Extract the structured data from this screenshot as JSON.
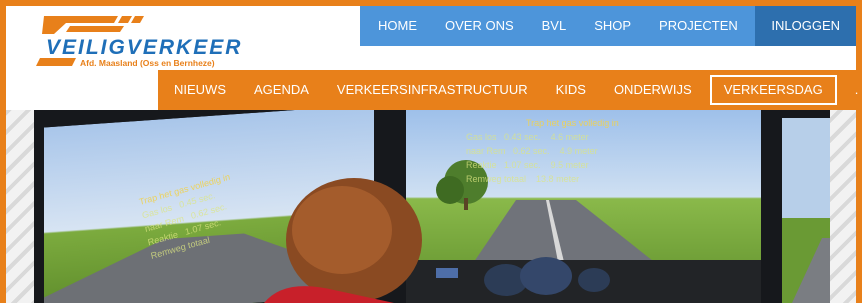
{
  "logo": {
    "wordmark": "VEILIGVERKEER",
    "subtitle": "Afd. Maasland (Oss en Bernheze)"
  },
  "top_nav": [
    "HOME",
    "OVER ONS",
    "BVL",
    "SHOP",
    "PROJECTEN"
  ],
  "login_label": "INLOGGEN",
  "sub_nav": [
    "NIEUWS",
    "AGENDA",
    "VERKEERSINFRASTRUCTUUR",
    "KIDS",
    "ONDERWIJS",
    "VERKEERSDAG",
    "."
  ],
  "active_sub_nav": "VERKEERSDAG",
  "banner": {
    "left_screen": {
      "title": "Trap het gas volledig in",
      "rows": [
        {
          "label": "Gas los",
          "value": "0.45 sec."
        },
        {
          "label": "naar Rem",
          "value": "0.62 sec."
        },
        {
          "label": "Reaktie",
          "value": "1.07 sec."
        },
        {
          "label": "Remweg totaal",
          "value": ""
        }
      ]
    },
    "center_screen": {
      "title": "Trap het gas volledig in",
      "rows": [
        {
          "label": "Gas los",
          "value": "0.43 sec.",
          "distance": "4.6 meter"
        },
        {
          "label": "naar Rem",
          "value": "0.62 sec.",
          "distance": "4.9 meter"
        },
        {
          "label": "Reaktie",
          "value": "1.07 sec.",
          "distance": "9.5 meter"
        },
        {
          "label": "Remweg totaal",
          "value": "",
          "distance": "13.8 meter"
        }
      ]
    }
  },
  "colors": {
    "brand_orange": "#e8801a",
    "nav_blue": "#4d95da",
    "nav_blue_dark": "#2d6fae",
    "logo_blue": "#1f6fb8"
  }
}
